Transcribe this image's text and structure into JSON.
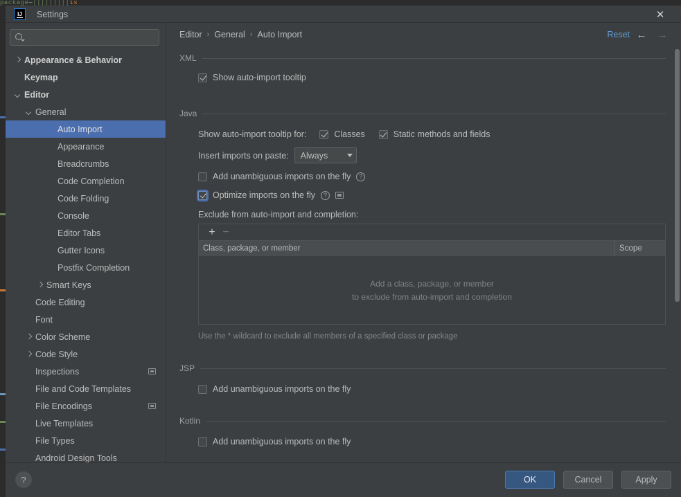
{
  "window": {
    "title": "Settings",
    "logo_text": "IJ",
    "close_icon": "close-icon"
  },
  "search": {
    "value": "",
    "placeholder": "",
    "icon": "search-icon"
  },
  "sidebar": {
    "items": [
      {
        "label": "Appearance & Behavior",
        "indent": 0,
        "twisty": "right",
        "bold": true,
        "selected": false,
        "badge": false
      },
      {
        "label": "Keymap",
        "indent": 0,
        "twisty": "none",
        "bold": true,
        "selected": false,
        "badge": false
      },
      {
        "label": "Editor",
        "indent": 0,
        "twisty": "down",
        "bold": true,
        "selected": false,
        "badge": false
      },
      {
        "label": "General",
        "indent": 1,
        "twisty": "down",
        "bold": false,
        "selected": false,
        "badge": false
      },
      {
        "label": "Auto Import",
        "indent": 3,
        "twisty": "none",
        "bold": false,
        "selected": true,
        "badge": false
      },
      {
        "label": "Appearance",
        "indent": 3,
        "twisty": "none",
        "bold": false,
        "selected": false,
        "badge": false
      },
      {
        "label": "Breadcrumbs",
        "indent": 3,
        "twisty": "none",
        "bold": false,
        "selected": false,
        "badge": false
      },
      {
        "label": "Code Completion",
        "indent": 3,
        "twisty": "none",
        "bold": false,
        "selected": false,
        "badge": false
      },
      {
        "label": "Code Folding",
        "indent": 3,
        "twisty": "none",
        "bold": false,
        "selected": false,
        "badge": false
      },
      {
        "label": "Console",
        "indent": 3,
        "twisty": "none",
        "bold": false,
        "selected": false,
        "badge": false
      },
      {
        "label": "Editor Tabs",
        "indent": 3,
        "twisty": "none",
        "bold": false,
        "selected": false,
        "badge": false
      },
      {
        "label": "Gutter Icons",
        "indent": 3,
        "twisty": "none",
        "bold": false,
        "selected": false,
        "badge": false
      },
      {
        "label": "Postfix Completion",
        "indent": 3,
        "twisty": "none",
        "bold": false,
        "selected": false,
        "badge": false
      },
      {
        "label": "Smart Keys",
        "indent": 2,
        "twisty": "right",
        "bold": false,
        "selected": false,
        "badge": false
      },
      {
        "label": "Code Editing",
        "indent": 1,
        "twisty": "none",
        "bold": false,
        "selected": false,
        "badge": false
      },
      {
        "label": "Font",
        "indent": 1,
        "twisty": "none",
        "bold": false,
        "selected": false,
        "badge": false
      },
      {
        "label": "Color Scheme",
        "indent": 1,
        "twisty": "right",
        "bold": false,
        "selected": false,
        "badge": false
      },
      {
        "label": "Code Style",
        "indent": 1,
        "twisty": "right",
        "bold": false,
        "selected": false,
        "badge": false
      },
      {
        "label": "Inspections",
        "indent": 1,
        "twisty": "none",
        "bold": false,
        "selected": false,
        "badge": true
      },
      {
        "label": "File and Code Templates",
        "indent": 1,
        "twisty": "none",
        "bold": false,
        "selected": false,
        "badge": false
      },
      {
        "label": "File Encodings",
        "indent": 1,
        "twisty": "none",
        "bold": false,
        "selected": false,
        "badge": true
      },
      {
        "label": "Live Templates",
        "indent": 1,
        "twisty": "none",
        "bold": false,
        "selected": false,
        "badge": false
      },
      {
        "label": "File Types",
        "indent": 1,
        "twisty": "none",
        "bold": false,
        "selected": false,
        "badge": false
      },
      {
        "label": "Android Design Tools",
        "indent": 1,
        "twisty": "none",
        "bold": false,
        "selected": false,
        "badge": false
      }
    ]
  },
  "breadcrumb": {
    "items": [
      "Editor",
      "General",
      "Auto Import"
    ],
    "separator": "›",
    "reset_label": "Reset",
    "back_icon": "arrow-left-icon",
    "forward_icon": "arrow-right-icon",
    "back_glyph": "←",
    "forward_glyph": "→"
  },
  "sections": {
    "xml": {
      "title": "XML",
      "show_tooltip_label": "Show auto-import tooltip",
      "show_tooltip_checked": true
    },
    "java": {
      "title": "Java",
      "tooltip_for_label": "Show auto-import tooltip for:",
      "classes_label": "Classes",
      "classes_checked": true,
      "static_label": "Static methods and fields",
      "static_checked": true,
      "insert_imports_label": "Insert imports on paste:",
      "insert_imports_value": "Always",
      "add_unambiguous_label": "Add unambiguous imports on the fly",
      "add_unambiguous_checked": false,
      "optimize_label": "Optimize imports on the fly",
      "optimize_checked": true,
      "exclude_label": "Exclude from auto-import and completion:",
      "table": {
        "add_glyph": "+",
        "remove_glyph": "−",
        "columns": [
          "Class, package, or member",
          "Scope"
        ],
        "rows": [],
        "empty_line_1": "Add a class, package, or member",
        "empty_line_2": "to exclude from auto-import and completion"
      },
      "hint": "Use the * wildcard to exclude all members of a specified class or package"
    },
    "jsp": {
      "title": "JSP",
      "add_unambiguous_label": "Add unambiguous imports on the fly",
      "add_unambiguous_checked": false
    },
    "kotlin": {
      "title": "Kotlin",
      "add_unambiguous_label": "Add unambiguous imports on the fly",
      "add_unambiguous_checked": false
    }
  },
  "footer": {
    "help_glyph": "?",
    "ok_label": "OK",
    "cancel_label": "Cancel",
    "apply_label": "Apply"
  },
  "colors": {
    "dialog_bg": "#3c3f41",
    "selection_blue": "#4b6eaf",
    "link_blue": "#5e9bd8",
    "primary_button": "#365880",
    "text": "#bbbbbb",
    "muted_text": "#83878a"
  },
  "backdrop": {
    "code_tokens": [
      {
        "text": "p",
        "color": "#6a8759"
      },
      {
        "text": "a",
        "color": "#6a8759"
      },
      {
        "text": "c",
        "color": "#6a8759"
      },
      {
        "text": "k",
        "color": "#6a8759"
      },
      {
        "text": "a",
        "color": "#6a8759"
      },
      {
        "text": "g",
        "color": "#6a8759"
      },
      {
        "text": "e",
        "color": "#6a8759"
      },
      {
        "text": " ",
        "color": "#2b2b2b"
      },
      {
        "text": "—",
        "color": "#a9b7c6"
      },
      {
        "text": "||||||",
        "color": "#6a8759"
      },
      {
        "text": "  ",
        "color": "#2b2b2b"
      },
      {
        "text": "|||",
        "color": "#6a8759"
      },
      {
        "text": "   ",
        "color": "#2b2b2b"
      },
      {
        "text": "ıs",
        "color": "#cc7832"
      }
    ]
  }
}
